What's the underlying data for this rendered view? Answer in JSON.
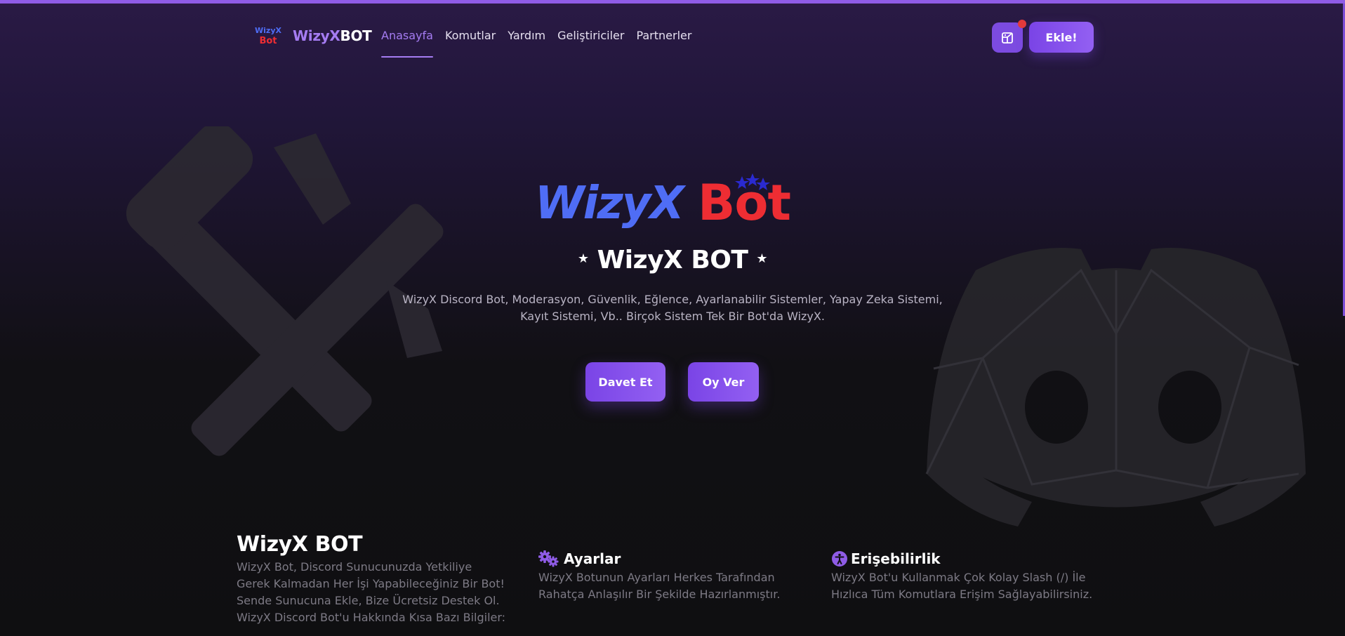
{
  "brand": {
    "logo_text_a": "Wizy",
    "logo_text_b": "X",
    "name_a": "WizyX",
    "name_b": "BOT",
    "logo_badge_text_top": "WizyX",
    "logo_badge_text_bottom": "Bot"
  },
  "nav": {
    "links": [
      "Anasayfa",
      "Komutlar",
      "Yardım",
      "Geliştiriciler",
      "Partnerler"
    ],
    "active_index": 0,
    "add_button": "Ekle!",
    "icon_button_icon": "dashboard-icon",
    "notification": true
  },
  "hero": {
    "logo_word_a": "WizyX",
    "logo_word_b": "Bot",
    "title": "WizyX BOT",
    "star": "★",
    "description_line1": "WizyX Discord Bot, Moderasyon, Güvenlik, Eğlence, Ayarlanabilir Sistemler, Yapay Zeka Sistemi,",
    "description_line2": "Kayıt Sistemi, Vb.. Birçok Sistem Tek Bir Bot'da WizyX.",
    "invite_button": "Davet Et",
    "vote_button": "Oy Ver"
  },
  "features": {
    "about": {
      "title": "WizyX BOT",
      "lines": [
        "WizyX Bot, Discord Sunucunuzda Yetkiliye",
        "Gerek Kalmadan Her İşi Yapabileceğiniz Bir Bot!",
        "Sende Sunucuna Ekle, Bize Ücretsiz Destek Ol.",
        "WizyX Discord Bot'u Hakkında Kısa Bazı Bilgiler:"
      ]
    },
    "settings": {
      "icon": "gears-icon",
      "title": "Ayarlar",
      "lines": [
        "WizyX Botunun Ayarları Herkes Tarafından",
        "Rahatça Anlaşılır Bir Şekilde Hazırlanmıştır."
      ]
    },
    "accessibility": {
      "icon": "accessibility-icon",
      "title": "Erişebilirlik",
      "lines": [
        "WizyX Bot'u Kullanmak Çok Kolay Slash (/) İle",
        "Hızlıca Tüm Komutlara Erişim Sağlayabilirsiniz."
      ]
    }
  },
  "colors": {
    "accent": "#8f5ce6",
    "logo_blue": "#4f6df5",
    "logo_red": "#ee2d33",
    "background_dark": "#0f0f11"
  },
  "background_icons": [
    "hammer-wrench-icon",
    "discord-icon"
  ]
}
